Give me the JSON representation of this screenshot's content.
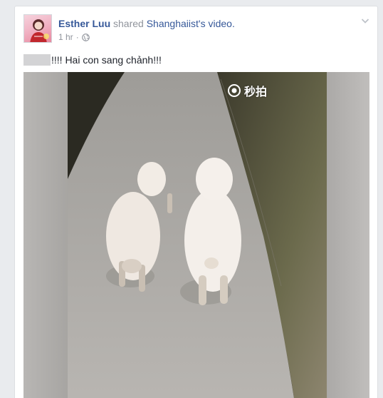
{
  "post": {
    "actor_name": "Esther Luu",
    "verb": "shared",
    "owner_name": "Shanghaiist",
    "owner_possessive": "'s",
    "media_type": "video.",
    "timestamp": "1 hr",
    "separator": "·",
    "privacy_icon": "globe-icon",
    "menu_icon": "chevron-down-icon",
    "caption_text": "!!!! Hai con sang chảnh!!!"
  },
  "video": {
    "watermark_text": "秒拍",
    "watermark_icon": "camera-eye-icon"
  },
  "colors": {
    "link": "#365899",
    "meta": "#90949c",
    "text": "#1d2129",
    "background": "#e9ebee"
  }
}
